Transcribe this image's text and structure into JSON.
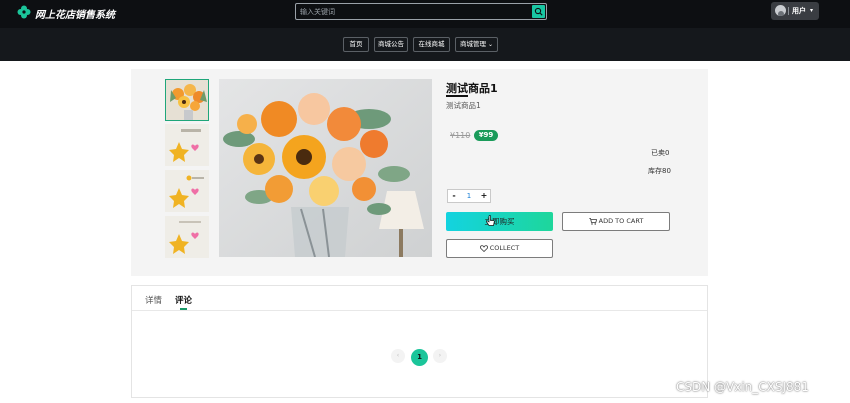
{
  "header": {
    "site_name": "网上花店销售系统",
    "search_placeholder": "输入关键词",
    "user_label": "用户"
  },
  "nav": {
    "items": [
      "首页",
      "商城公告",
      "在线商城",
      "商城管理"
    ]
  },
  "product": {
    "title": "测试商品1",
    "subtitle": "测试商品1",
    "old_price": "¥110",
    "price": "¥99",
    "sold": "已卖0",
    "stock": "库存80",
    "quantity": "1",
    "qty_minus": "-",
    "qty_plus": "+",
    "buy_label": "立即购买",
    "cart_label": "ADD TO CART",
    "collect_label": "COLLECT"
  },
  "tabs": {
    "detail": "详情",
    "comment": "评论"
  },
  "pagination": {
    "prev": "‹",
    "current": "1",
    "next": "›"
  },
  "watermark": "CSDN @Vxin_CXSJ881",
  "colors": {
    "accent": "#1bc59a",
    "price_badge": "#1a9b5a",
    "topbar": "#0d0f12"
  }
}
